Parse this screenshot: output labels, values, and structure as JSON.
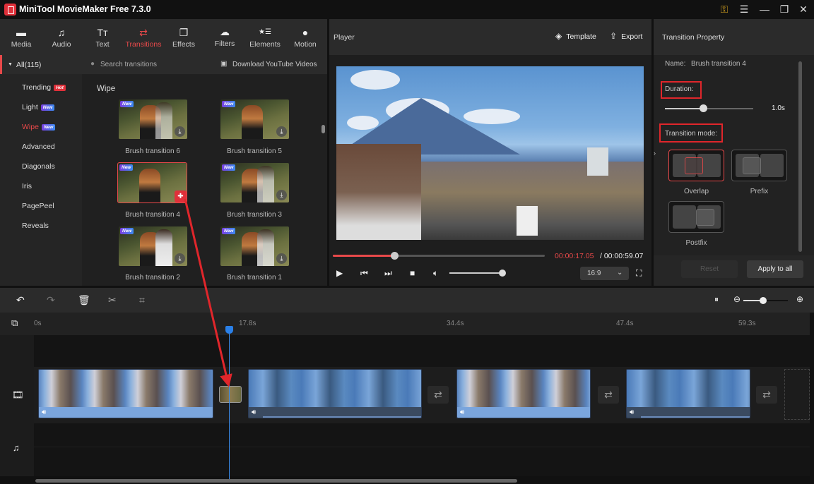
{
  "app": {
    "title": "MiniTool MovieMaker Free 7.3.0"
  },
  "window_controls": {
    "key": "⚿",
    "menu": "☰",
    "minimize": "—",
    "maximize": "❐",
    "close": "✕"
  },
  "tabs": [
    {
      "label": "Media",
      "icon": "▬"
    },
    {
      "label": "Audio",
      "icon": "♫"
    },
    {
      "label": "Text",
      "icon": "Tт"
    },
    {
      "label": "Transitions",
      "icon": "⇄",
      "active": true
    },
    {
      "label": "Effects",
      "icon": "❐"
    },
    {
      "label": "Filters",
      "icon": "☁"
    },
    {
      "label": "Elements",
      "icon": "★☰"
    },
    {
      "label": "Motion",
      "icon": "●"
    }
  ],
  "categories": {
    "header": "All(115)",
    "items": [
      {
        "label": "Trending",
        "badge": "Hot"
      },
      {
        "label": "Light",
        "badge": "New"
      },
      {
        "label": "Wipe",
        "badge": "New",
        "active": true
      },
      {
        "label": "Advanced"
      },
      {
        "label": "Diagonals"
      },
      {
        "label": "Iris"
      },
      {
        "label": "PagePeel"
      },
      {
        "label": "Reveals"
      }
    ]
  },
  "search": {
    "placeholder": "Search transitions",
    "download_label": "Download YouTube Videos"
  },
  "grid": {
    "section_title": "Wipe",
    "items": [
      {
        "label": "Brush transition 6",
        "badge": "New"
      },
      {
        "label": "Brush transition 5",
        "badge": "New"
      },
      {
        "label": "Brush transition 4",
        "badge": "New",
        "selected": true
      },
      {
        "label": "Brush transition 3",
        "badge": "New"
      },
      {
        "label": "Brush transition 2",
        "badge": "New"
      },
      {
        "label": "Brush transition 1",
        "badge": "New"
      }
    ]
  },
  "player": {
    "title": "Player",
    "template_label": "Template",
    "export_label": "Export",
    "current_time": "00:00:17.05",
    "total_time": "/ 00:00:59.07",
    "progress_fraction": 0.29,
    "volume_fraction": 1.0,
    "aspect_ratio": "16:9"
  },
  "property": {
    "title": "Transition Property",
    "name_label": "Name:",
    "name_value": "Brush transition 4",
    "duration_label": "Duration:",
    "duration_value": "1.0s",
    "duration_fraction": 0.43,
    "mode_label": "Transition mode:",
    "modes": [
      {
        "label": "Overlap",
        "selected": true
      },
      {
        "label": "Prefix"
      },
      {
        "label": "Postfix"
      }
    ],
    "reset_label": "Reset",
    "apply_label": "Apply to all"
  },
  "timeline": {
    "ticks": [
      "0s",
      "17.8s",
      "34.4s",
      "47.4s",
      "59.3s"
    ],
    "clips": [
      {
        "type": "city"
      },
      {
        "type": "lake"
      },
      {
        "type": "city"
      },
      {
        "type": "lake"
      }
    ]
  },
  "colors": {
    "accent": "#e8494a",
    "playhead": "#3a8ae8",
    "annotation": "#e0262b"
  }
}
